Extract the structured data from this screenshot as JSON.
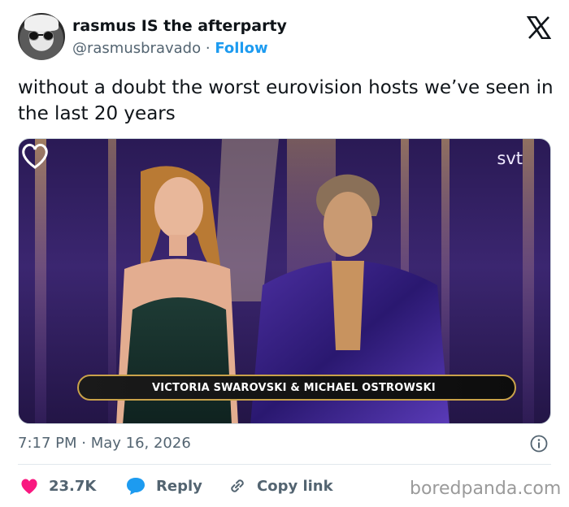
{
  "author": {
    "display_name": "rasmus IS the afterparty",
    "handle": "@rasmusbravado",
    "separator": "·",
    "follow_label": "Follow"
  },
  "tweet": {
    "text": "without a doubt the worst eurovision hosts we’ve seen in the last 20 years",
    "timestamp": "7:17 PM · May 16, 2026"
  },
  "media": {
    "broadcaster": "svt",
    "caption": "VICTORIA SWAROVSKI  &  MICHAEL OSTROWSKI"
  },
  "actions": {
    "likes": "23.7K",
    "reply_label": "Reply",
    "copy_label": "Copy link"
  },
  "watermark": "boredpanda.com",
  "colors": {
    "accent": "#1d9bf0",
    "like": "#f91880",
    "text": "#0f1419",
    "muted": "#536471"
  }
}
